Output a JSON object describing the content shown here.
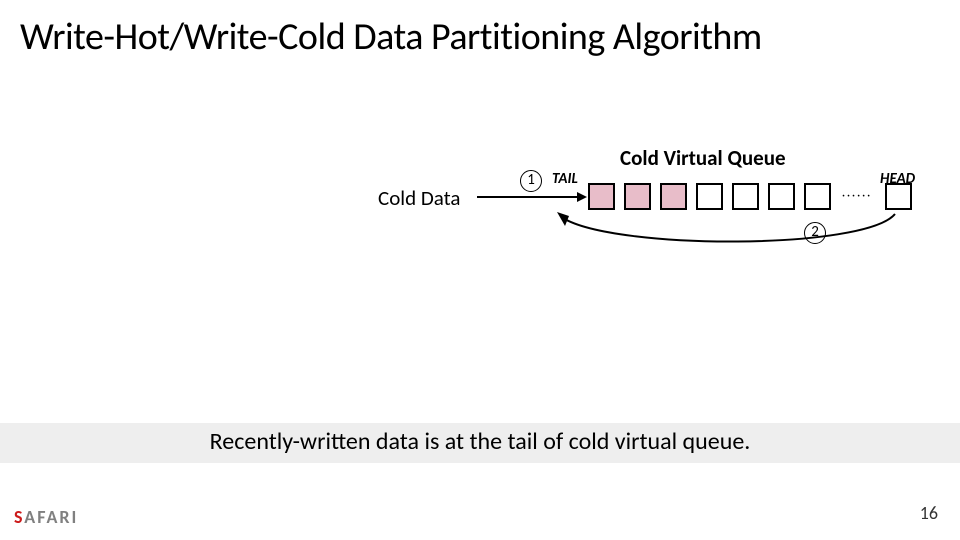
{
  "title": "Write-Hot/Write-Cold Data Partitioning Algorithm",
  "queue": {
    "title": "Cold Virtual Queue",
    "tail": "TAIL",
    "head": "HEAD",
    "cold_data_label": "Cold Data",
    "step1": "1",
    "step2": "2",
    "boxes_filled": 3,
    "boxes_empty": 4,
    "ellipsis": "······"
  },
  "caption": "Recently-written data is at the tail of cold virtual queue.",
  "footer": {
    "safari_red": "S",
    "safari_gray": "AFARI",
    "page": "16"
  }
}
